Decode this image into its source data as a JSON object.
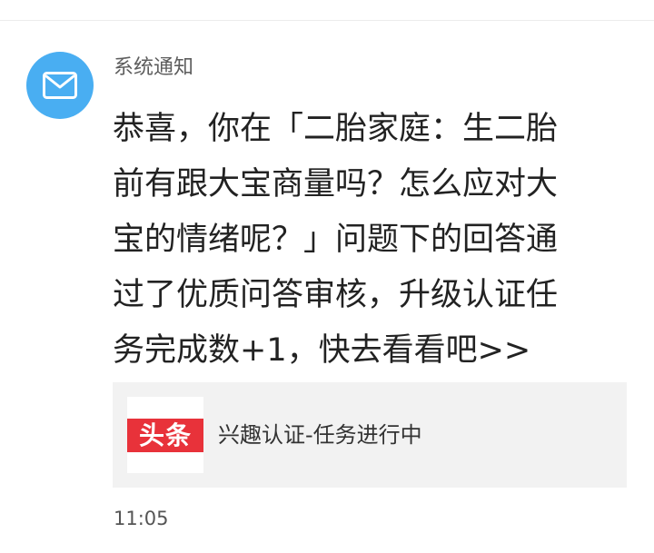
{
  "notification": {
    "avatar_icon": "mail-envelope-icon",
    "avatar_color": "#49aef2",
    "sender": "系统通知",
    "message_lines": [
      "恭喜，你在「二胎家庭：生二胎",
      "前有跟大宝商量吗？怎么应对大",
      "宝的情绪呢？」问题下的回答通",
      "过了优质问答审核，升级认证任",
      "务完成数+1，快去看看吧>>"
    ],
    "card": {
      "logo_text": "头条",
      "logo_color": "#e8323a",
      "title": "兴趣认证-任务进行中"
    },
    "time": "11:05"
  }
}
